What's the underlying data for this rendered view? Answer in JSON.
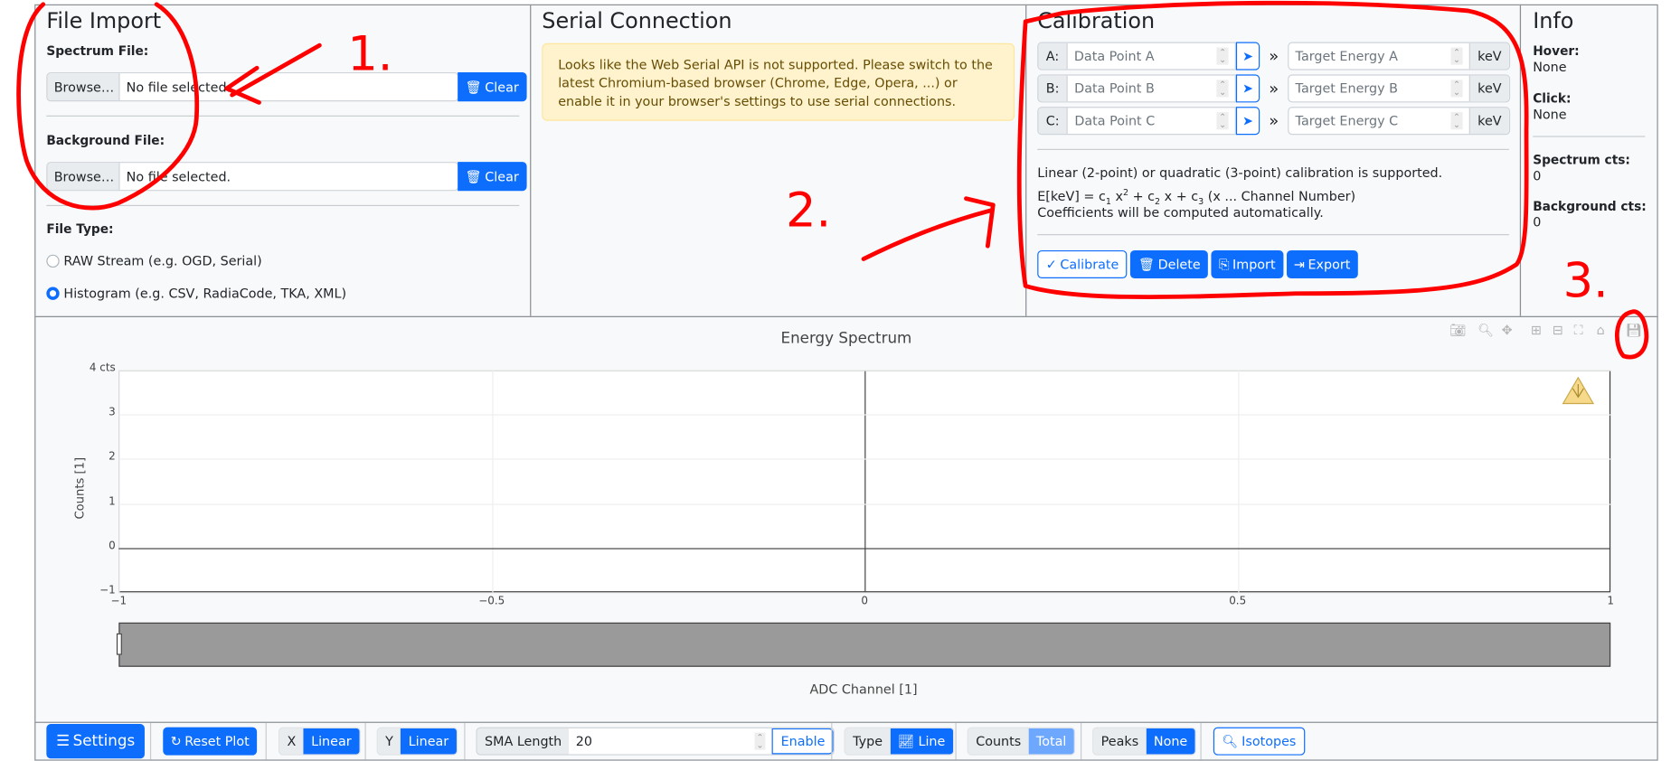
{
  "file_import": {
    "title": "File Import",
    "spectrum_label": "Spectrum File:",
    "background_label": "Background File:",
    "browse": "Browse…",
    "no_file": "No file selected.",
    "clear": "Clear",
    "file_type_label": "File Type:",
    "options": [
      {
        "label": "RAW Stream (e.g. OGD, Serial)",
        "checked": false
      },
      {
        "label": "Histogram (e.g. CSV, RadiaCode, TKA, XML)",
        "checked": true
      }
    ]
  },
  "serial": {
    "title": "Serial Connection",
    "alert": "Looks like the Web Serial API is not supported. Please switch to the latest Chromium-based browser (Chrome, Edge, Opera, ...) or enable it in your browser's settings to use serial connections."
  },
  "calibration": {
    "title": "Calibration",
    "rows": [
      {
        "prefix": "A:",
        "point_placeholder": "Data Point A",
        "energy_placeholder": "Target Energy A"
      },
      {
        "prefix": "B:",
        "point_placeholder": "Data Point B",
        "energy_placeholder": "Target Energy B"
      },
      {
        "prefix": "C:",
        "point_placeholder": "Data Point C",
        "energy_placeholder": "Target Energy C"
      }
    ],
    "unit": "keV",
    "arrow": "»",
    "line1": "Linear (2-point) or quadratic (3-point) calibration is supported.",
    "formula": {
      "a": "E[keV] = c",
      "s1": "1",
      "b": " x",
      "sup": "2",
      "c": " + c",
      "s2": "2",
      "d": " x + c",
      "s3": "3",
      "e": " (x ... Channel Number)"
    },
    "line3": "Coefficients will be computed automatically.",
    "buttons": {
      "calibrate": "Calibrate",
      "delete": "Delete",
      "import": "Import",
      "export": "Export"
    }
  },
  "info": {
    "title": "Info",
    "hover_label": "Hover:",
    "hover": "None",
    "click_label": "Click:",
    "click": "None",
    "spectrum_label": "Spectrum cts:",
    "spectrum": "0",
    "background_label": "Background cts:",
    "background": "0"
  },
  "plot": {
    "title": "Energy Spectrum",
    "ylabel": "Counts [1]",
    "xlabel": "ADC Channel [1]",
    "yticks": [
      "4 cts",
      "3",
      "2",
      "1",
      "0",
      "−1"
    ],
    "xticks": [
      "−1",
      "−0.5",
      "0",
      "0.5",
      "1"
    ],
    "xlim": [
      -1,
      1
    ],
    "ylim": [
      -1,
      4
    ],
    "modebar": [
      "camera-icon",
      "zoom-icon",
      "pan-icon",
      "zoom-in-icon",
      "zoom-out-icon",
      "autoscale-icon",
      "home-icon",
      "save-icon"
    ]
  },
  "toolbar": {
    "settings": "Settings",
    "reset": "Reset Plot",
    "x_label": "X",
    "x_value": "Linear",
    "y_label": "Y",
    "y_value": "Linear",
    "sma_label": "SMA Length",
    "sma_value": "20",
    "enable": "Enable",
    "type_label": "Type",
    "type_value": "Line",
    "counts_label": "Counts",
    "counts_value": "Total",
    "peaks_label": "Peaks",
    "peaks_value": "None",
    "isotopes": "Isotopes"
  },
  "annotations": {
    "n1": "1.",
    "n2": "2.",
    "n3": "3.",
    "color": "#ff0000"
  },
  "colors": {
    "primary": "#0d6efd",
    "warning_bg": "#fff3cd"
  }
}
